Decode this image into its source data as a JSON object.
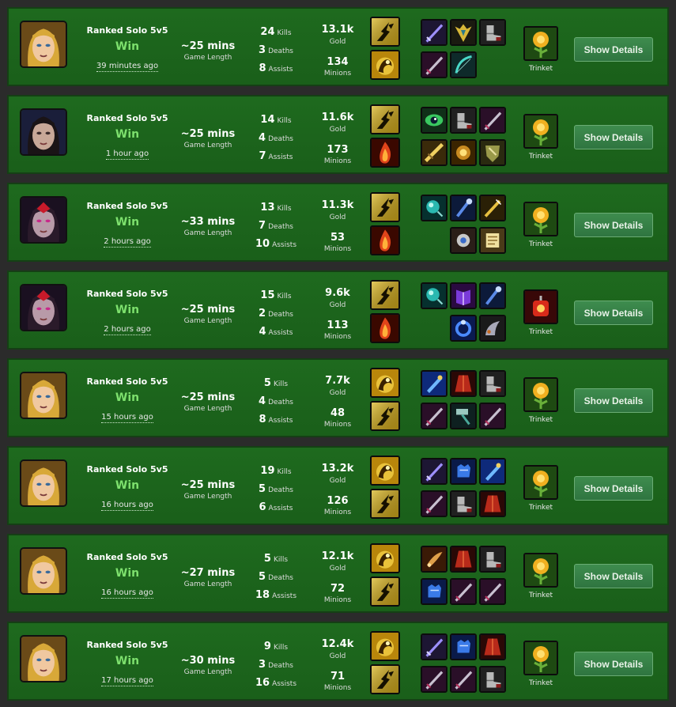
{
  "labels": {
    "game_length": "Game Length",
    "kills": "Kills",
    "deaths": "Deaths",
    "assists": "Assists",
    "gold": "Gold",
    "minions": "Minions",
    "trinket": "Trinket",
    "show_details": "Show Details"
  },
  "matches": [
    {
      "champion": "blonde-champion",
      "queue": "Ranked Solo 5v5",
      "result": "Win",
      "time_ago": "39 minutes ago",
      "duration": "~25 mins",
      "kills": "24",
      "deaths": "3",
      "assists": "8",
      "gold": "13.1k",
      "minions": "134",
      "spells": [
        "flash",
        "ignite-gold"
      ],
      "items_top": [
        "sword-violet",
        "helm-gold",
        "boots-steel"
      ],
      "items_bottom": [
        "sword-dark",
        "bow-teal"
      ],
      "trinket": "sun-flower"
    },
    {
      "champion": "dark-haired-champion",
      "queue": "Ranked Solo 5v5",
      "result": "Win",
      "time_ago": "1 hour ago",
      "duration": "~25 mins",
      "kills": "14",
      "deaths": "4",
      "assists": "7",
      "gold": "11.6k",
      "minions": "173",
      "spells": [
        "flash",
        "ignite"
      ],
      "items_top": [
        "eye-green",
        "boots-steel",
        "sword-dark"
      ],
      "items_bottom": [
        "blade-gold",
        "gauntlet-gold",
        "shield-gold"
      ],
      "trinket": "sun-flower"
    },
    {
      "champion": "red-crown-champion",
      "queue": "Ranked Solo 5v5",
      "result": "Win",
      "time_ago": "2 hours ago",
      "duration": "~33 mins",
      "kills": "13",
      "deaths": "7",
      "assists": "10",
      "gold": "11.3k",
      "minions": "53",
      "spells": [
        "flash",
        "ignite"
      ],
      "items_top": [
        "orb-teal",
        "staff-blue",
        "wand-gold"
      ],
      "items_bottom": [
        "",
        "medallion-steel",
        "scroll-gold"
      ],
      "trinket": "sun-flower"
    },
    {
      "champion": "red-crown-champion",
      "queue": "Ranked Solo 5v5",
      "result": "Win",
      "time_ago": "2 hours ago",
      "duration": "~25 mins",
      "kills": "15",
      "deaths": "2",
      "assists": "4",
      "gold": "9.6k",
      "minions": "113",
      "spells": [
        "flash",
        "ignite"
      ],
      "items_top": [
        "orb-teal",
        "book-purple",
        "staff-blue"
      ],
      "items_bottom": [
        "",
        "ring-blue",
        "horn-steel"
      ],
      "trinket": "red-lantern"
    },
    {
      "champion": "blonde-champion",
      "queue": "Ranked Solo 5v5",
      "result": "Win",
      "time_ago": "15 hours ago",
      "duration": "~25 mins",
      "kills": "5",
      "deaths": "4",
      "assists": "8",
      "gold": "7.7k",
      "minions": "48",
      "spells": [
        "ignite-gold",
        "flash"
      ],
      "items_top": [
        "sword-blue",
        "cloak-red",
        "boots-steel"
      ],
      "items_bottom": [
        "sword-dark",
        "hammer-teal",
        "sword-dark"
      ],
      "trinket": "sun-flower"
    },
    {
      "champion": "blonde-champion",
      "queue": "Ranked Solo 5v5",
      "result": "Win",
      "time_ago": "16 hours ago",
      "duration": "~25 mins",
      "kills": "19",
      "deaths": "5",
      "assists": "6",
      "gold": "13.2k",
      "minions": "126",
      "spells": [
        "ignite-gold",
        "flash"
      ],
      "items_top": [
        "sword-violet",
        "gauntlet-blue",
        "sword-blue"
      ],
      "items_bottom": [
        "sword-dark",
        "boots-steel",
        "cloak-red"
      ],
      "trinket": "sun-flower"
    },
    {
      "champion": "blonde-champion",
      "queue": "Ranked Solo 5v5",
      "result": "Win",
      "time_ago": "16 hours ago",
      "duration": "~27 mins",
      "kills": "5",
      "deaths": "5",
      "assists": "18",
      "gold": "12.1k",
      "minions": "72",
      "spells": [
        "ignite-gold",
        "flash"
      ],
      "items_top": [
        "dagger-gold",
        "cloak-red",
        "boots-steel"
      ],
      "items_bottom": [
        "gauntlet-blue",
        "sword-dark",
        "sword-dark"
      ],
      "trinket": "sun-flower"
    },
    {
      "champion": "blonde-champion",
      "queue": "Ranked Solo 5v5",
      "result": "Win",
      "time_ago": "17 hours ago",
      "duration": "~30 mins",
      "kills": "9",
      "deaths": "3",
      "assists": "16",
      "gold": "12.4k",
      "minions": "71",
      "spells": [
        "ignite-gold",
        "flash"
      ],
      "items_top": [
        "sword-violet",
        "gauntlet-blue",
        "cloak-red"
      ],
      "items_bottom": [
        "sword-dark",
        "sword-dark",
        "boots-steel"
      ],
      "trinket": "sun-flower"
    }
  ]
}
